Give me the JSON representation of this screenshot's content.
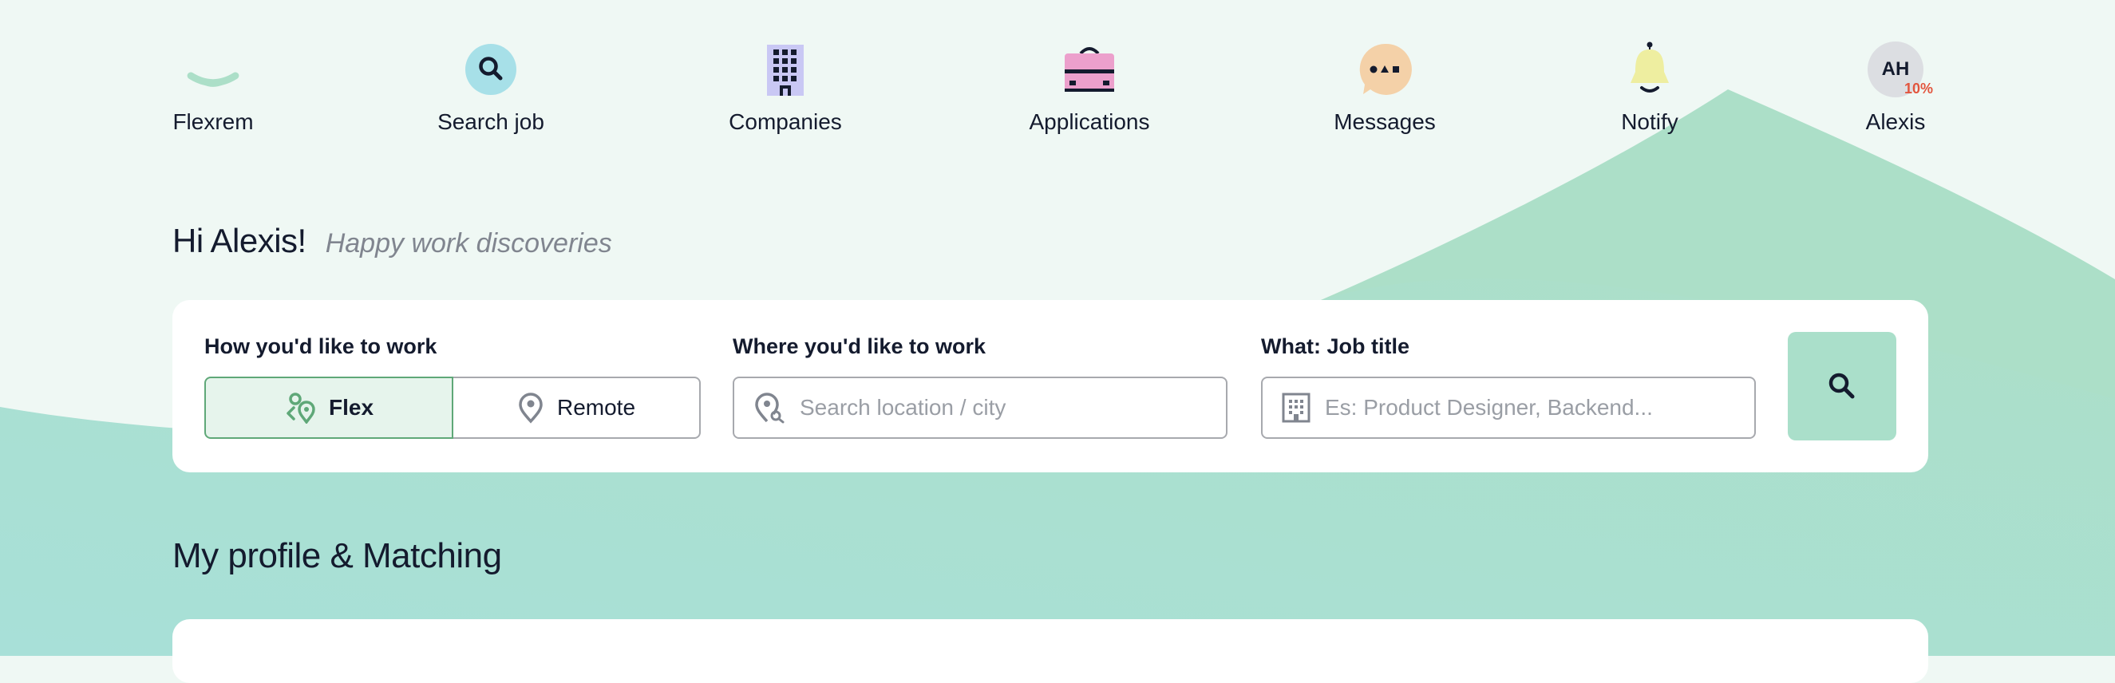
{
  "nav": {
    "items": [
      {
        "label": "Flexrem",
        "icon": "flexrem-logo-icon"
      },
      {
        "label": "Search job",
        "icon": "search-icon"
      },
      {
        "label": "Companies",
        "icon": "building-icon"
      },
      {
        "label": "Applications",
        "icon": "briefcase-icon"
      },
      {
        "label": "Messages",
        "icon": "chat-bubble-icon"
      },
      {
        "label": "Notify",
        "icon": "bell-icon"
      },
      {
        "label": "Alexis",
        "icon": "avatar"
      }
    ],
    "avatar": {
      "initials": "AH",
      "completion": "10%"
    }
  },
  "greeting": {
    "title": "Hi Alexis!",
    "subtitle": "Happy work discoveries"
  },
  "search": {
    "work_mode": {
      "label": "How you'd like to work",
      "options": [
        "Flex",
        "Remote"
      ],
      "selected": "Flex"
    },
    "location": {
      "label": "Where you'd like to work",
      "placeholder": "Search location / city",
      "value": ""
    },
    "job": {
      "label": "What: Job title",
      "placeholder": "Es: Product Designer, Backend...",
      "value": ""
    },
    "submit_icon": "search-icon"
  },
  "profile": {
    "title": "My profile & Matching"
  },
  "colors": {
    "accent": "#aadfca",
    "teal": "#a7e0d6",
    "green": "#5fa878",
    "background": "#eff8f4",
    "text": "#141b2e",
    "badge": "#e2553e"
  }
}
